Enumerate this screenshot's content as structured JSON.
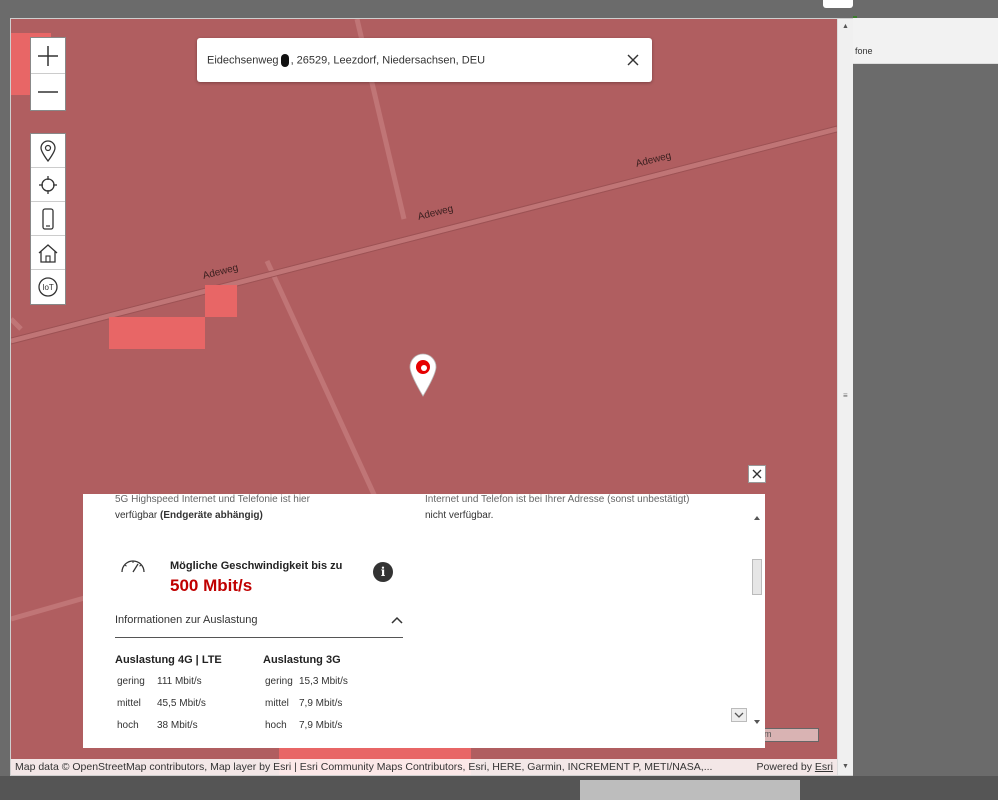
{
  "search": {
    "address_prefix": "Eidechsenweg",
    "address_suffix": ", 26529, Leezdorf, Niedersachsen, DEU"
  },
  "map": {
    "roads": [
      "Adeweg",
      "Adeweg",
      "Adeweg"
    ],
    "fill_color": "#b05e60",
    "highlight_color": "#e86666"
  },
  "popup": {
    "left_text_top": "5G Highspeed Internet und Telefonie ist hier",
    "left_text_avail": "verfügbar",
    "left_text_bold": "(Endgeräte abhängig)",
    "right_text_top": "Internet und Telefon ist bei Ihrer Adresse (sonst unbestätigt)",
    "right_text_bottom": "nicht verfügbar.",
    "speed_label": "Mögliche Geschwindigkeit bis zu",
    "speed_value": "500 Mbit/s",
    "accordion_label": "Informationen zur Auslastung",
    "load_4g": {
      "title": "Auslastung 4G | LTE",
      "rows": [
        {
          "level": "gering",
          "value": "111 Mbit/s"
        },
        {
          "level": "mittel",
          "value": "45,5 Mbit/s"
        },
        {
          "level": "hoch",
          "value": "38 Mbit/s"
        }
      ]
    },
    "load_3g": {
      "title": "Auslastung 3G",
      "rows": [
        {
          "level": "gering",
          "value": "15,3 Mbit/s"
        },
        {
          "level": "mittel",
          "value": "7,9 Mbit/s"
        },
        {
          "level": "hoch",
          "value": "7,9 Mbit/s"
        }
      ]
    }
  },
  "attribution": {
    "left": "Map data © OpenStreetMap contributors, Map layer by Esri | Esri Community Maps Contributors, Esri, HERE, Garmin, INCREMENT P, METI/NASA,...",
    "powered": "Powered by",
    "esri": "Esri"
  },
  "background": {
    "right_label": "fone",
    "hidden_button": "m"
  }
}
